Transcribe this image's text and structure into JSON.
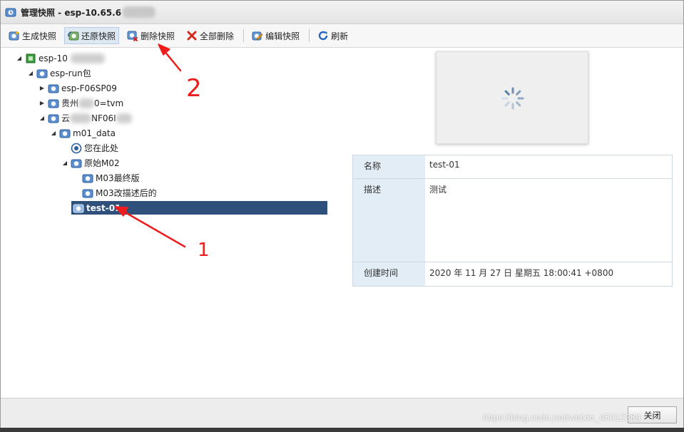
{
  "window": {
    "title": "管理快照 - esp-10.65.6"
  },
  "toolbar": {
    "create": "生成快照",
    "restore": "还原快照",
    "delete": "删除快照",
    "delete_all": "全部删除",
    "edit": "编辑快照",
    "refresh": "刷新"
  },
  "tree": {
    "root": "esp-10",
    "n1": "esp-run包",
    "n2": "esp-F06SP09",
    "n3a": "贵州",
    "n3b": "0=tvm",
    "n4a": "云",
    "n4b": "NF06I",
    "n5": "m01_data",
    "you_are_here": "您在此处",
    "n6": "原始M02",
    "n7": "M03最终版",
    "n8": "M03改描述后的",
    "selected": "test-01"
  },
  "details": {
    "name_label": "名称",
    "name_value": "test-01",
    "desc_label": "描述",
    "desc_value": "测试",
    "time_label": "创建时间",
    "time_value": "2020 年 11 月 27 日 星期五 18:00:41 +0800"
  },
  "footer": {
    "close": "关闭"
  },
  "annotations": {
    "one": "1",
    "two": "2"
  },
  "watermark": "https://blog.csdn.net/weixin_45012389",
  "colors": {
    "selected_bg": "#2e507a",
    "label_bg": "#e3edf5",
    "annotation": "#ee1c1c"
  }
}
